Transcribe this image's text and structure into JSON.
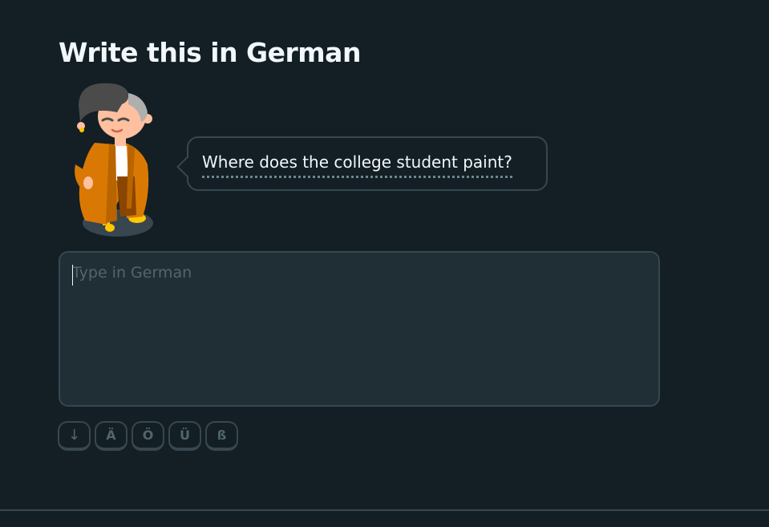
{
  "challenge": {
    "title": "Write this in German",
    "prompt": "Where does the college student paint?",
    "character_icon": "college-student-character-icon"
  },
  "answer": {
    "value": "",
    "placeholder": "Type in German"
  },
  "special_keys": {
    "toggle": "↓",
    "a_umlaut": "Ä",
    "o_umlaut": "Ö",
    "u_umlaut": "Ü",
    "eszett": "ß"
  },
  "colors": {
    "background": "#131f24",
    "border": "#37464f",
    "input_background": "#202f36",
    "text": "#f1f7fb",
    "muted": "#52656d",
    "character_jacket": "#d97904"
  }
}
